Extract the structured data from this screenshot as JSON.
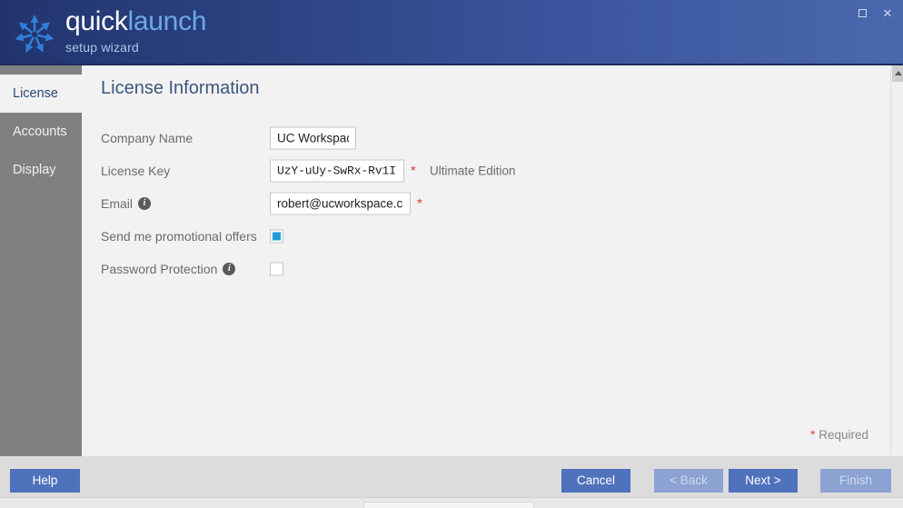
{
  "window": {
    "brand_primary": "quick",
    "brand_secondary": "launch",
    "subtitle": "setup wizard",
    "logo_icon": "starburst-arrows-logo",
    "maximize_icon": "maximize-icon",
    "close_icon": "close-icon",
    "close_glyph": "✕",
    "header_gradient_from": "#22346e",
    "header_gradient_to": "#4a68ae"
  },
  "sidebar": {
    "items": [
      {
        "label": "License",
        "active": true
      },
      {
        "label": "Accounts",
        "active": false
      },
      {
        "label": "Display",
        "active": false
      }
    ]
  },
  "main": {
    "title": "License Information",
    "rows": [
      {
        "label": "Company Name",
        "value": "UC Workspace",
        "required": false,
        "info": false
      },
      {
        "label": "License Key",
        "value": "UzY-uUy-SwRx-Rv1I",
        "required": true,
        "required_marker": "*",
        "info": false,
        "note": "Ultimate Edition"
      },
      {
        "label": "Email",
        "value": "robert@ucworkspace.com",
        "required": true,
        "required_marker": "*",
        "info": true,
        "info_glyph": "i"
      }
    ],
    "checkboxes": [
      {
        "label": "Send me promotional offers",
        "checked": true,
        "info": false
      },
      {
        "label": "Password Protection",
        "checked": false,
        "info": true,
        "info_glyph": "i"
      }
    ],
    "required_note_star": "*",
    "required_note_text": "Required",
    "checkbox_accent": "#1e9cd7"
  },
  "footer": {
    "help_label": "Help",
    "cancel_label": "Cancel",
    "back_label": "< Back",
    "next_label": "Next >",
    "finish_label": "Finish",
    "button_color": "#4f72bd",
    "button_disabled_color": "#8ba2d3"
  }
}
